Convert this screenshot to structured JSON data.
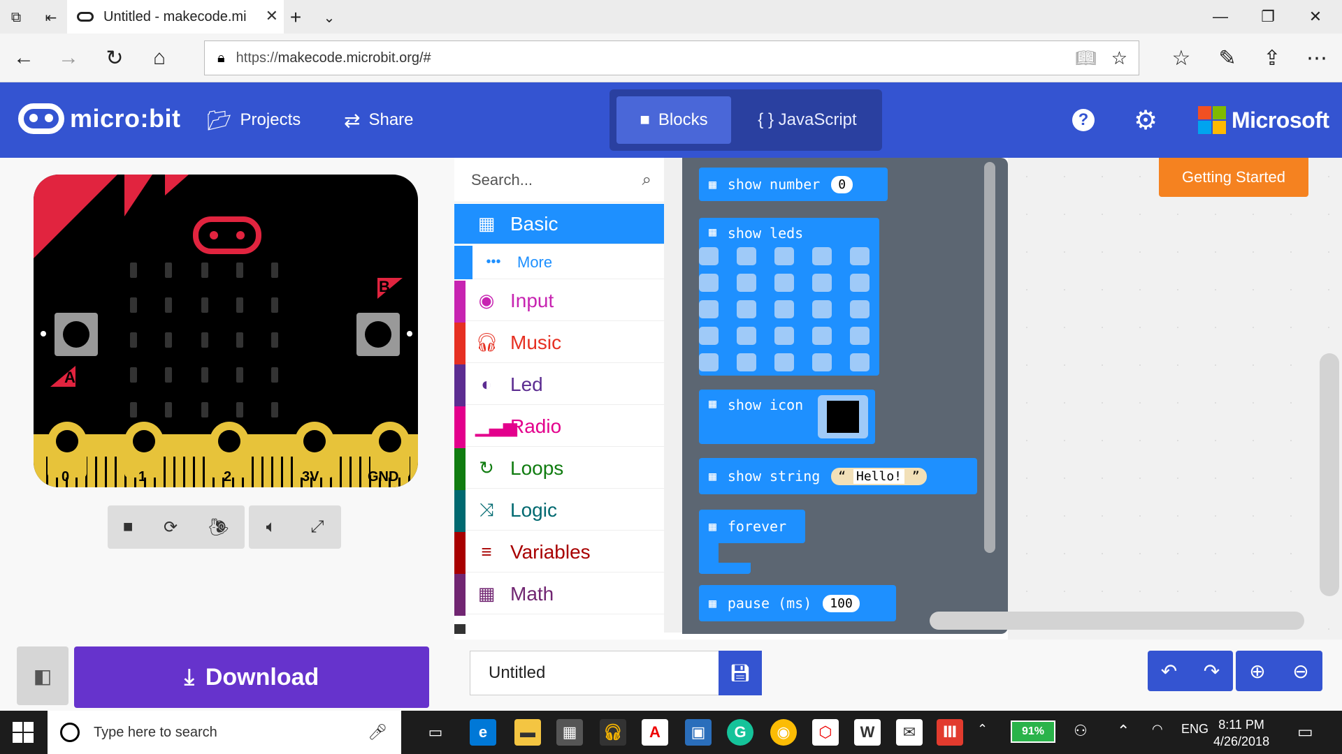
{
  "browser": {
    "tab_title": "Untitled - makecode.mi",
    "url_proto": "https://",
    "url_rest": "makecode.microbit.org/#"
  },
  "header": {
    "logo_text": "micro:bit",
    "projects_label": "Projects",
    "share_label": "Share",
    "blocks_label": "Blocks",
    "javascript_label": "{ } JavaScript",
    "brand": "Microsoft"
  },
  "simulator": {
    "button_a": "A",
    "button_b": "B",
    "pins": [
      "0",
      "1",
      "2",
      "3V",
      "GND"
    ]
  },
  "toolbox": {
    "search_placeholder": "Search...",
    "categories": [
      {
        "label": "Basic",
        "color": "#1e90ff"
      },
      {
        "label": "More",
        "color": "#1e90ff"
      },
      {
        "label": "Input",
        "color": "#c724b1"
      },
      {
        "label": "Music",
        "color": "#e63022"
      },
      {
        "label": "Led",
        "color": "#5c2d91"
      },
      {
        "label": "Radio",
        "color": "#e3008c"
      },
      {
        "label": "Loops",
        "color": "#107c10"
      },
      {
        "label": "Logic",
        "color": "#006970"
      },
      {
        "label": "Variables",
        "color": "#a80000"
      },
      {
        "label": "Math",
        "color": "#712672"
      }
    ]
  },
  "flyout": {
    "show_number": "show number",
    "show_number_val": "0",
    "show_leds": "show leds",
    "show_icon": "show icon",
    "show_string": "show string",
    "show_string_val": "Hello!",
    "forever": "forever",
    "pause": "pause (ms)",
    "pause_val": "100"
  },
  "workspace": {
    "getting_started": "Getting Started"
  },
  "bottom": {
    "download_label": "Download",
    "project_name": "Untitled"
  },
  "taskbar": {
    "search_placeholder": "Type here to search",
    "battery": "91%",
    "lang": "ENG",
    "time": "8:11 PM",
    "date": "4/26/2018"
  }
}
